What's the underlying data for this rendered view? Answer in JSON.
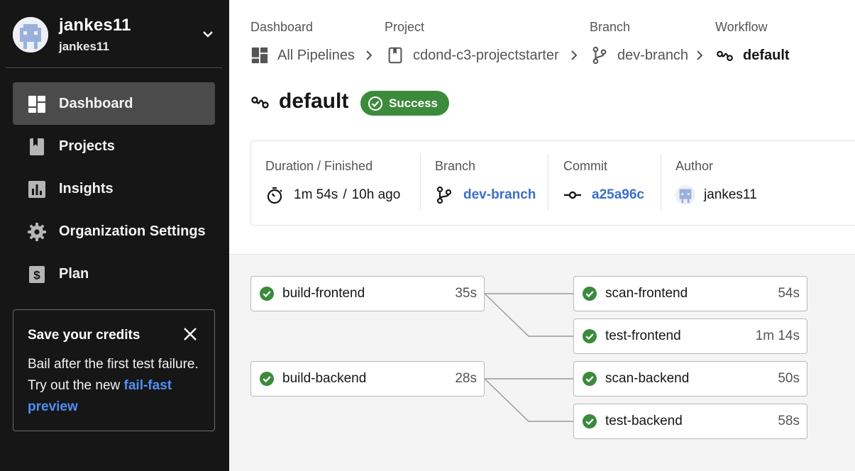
{
  "user": {
    "name": "jankes11",
    "org": "jankes11"
  },
  "nav": {
    "items": [
      {
        "label": "Dashboard",
        "icon": "dashboard-icon",
        "active": true
      },
      {
        "label": "Projects",
        "icon": "bookmark-icon"
      },
      {
        "label": "Insights",
        "icon": "chart-icon"
      },
      {
        "label": "Organization Settings",
        "icon": "gear-icon"
      },
      {
        "label": "Plan",
        "icon": "dollar-icon"
      }
    ]
  },
  "promo": {
    "title": "Save your credits",
    "body": "Bail after the first test failure. Try out the new ",
    "link": "fail-fast preview"
  },
  "breadcrumbs": [
    {
      "header": "Dashboard",
      "label": "All Pipelines",
      "icon": "dashboard-icon"
    },
    {
      "header": "Project",
      "label": "cdond-c3-projectstarter",
      "icon": "bookmark-icon"
    },
    {
      "header": "Branch",
      "label": "dev-branch",
      "icon": "branch-icon"
    },
    {
      "header": "Workflow",
      "label": "default",
      "icon": "workflow-icon"
    }
  ],
  "workflow": {
    "title": "default",
    "status": "Success",
    "status_color": "#3c8a3c"
  },
  "info": {
    "duration": {
      "label": "Duration / Finished",
      "duration": "1m 54s",
      "separator": "/",
      "finished": "10h ago"
    },
    "branch": {
      "label": "Branch",
      "value": "dev-branch"
    },
    "commit": {
      "label": "Commit",
      "value": "a25a96c"
    },
    "author": {
      "label": "Author",
      "value": "jankes11"
    }
  },
  "jobs": [
    {
      "name": "build-frontend",
      "duration": "35s"
    },
    {
      "name": "scan-frontend",
      "duration": "54s"
    },
    {
      "name": "test-frontend",
      "duration": "1m 14s"
    },
    {
      "name": "build-backend",
      "duration": "28s"
    },
    {
      "name": "scan-backend",
      "duration": "50s"
    },
    {
      "name": "test-backend",
      "duration": "58s"
    }
  ],
  "colors": {
    "sidebar": "#161616",
    "success": "#3c8a3c",
    "link": "#3b6fc9",
    "promo_link": "#4f8ff7"
  }
}
